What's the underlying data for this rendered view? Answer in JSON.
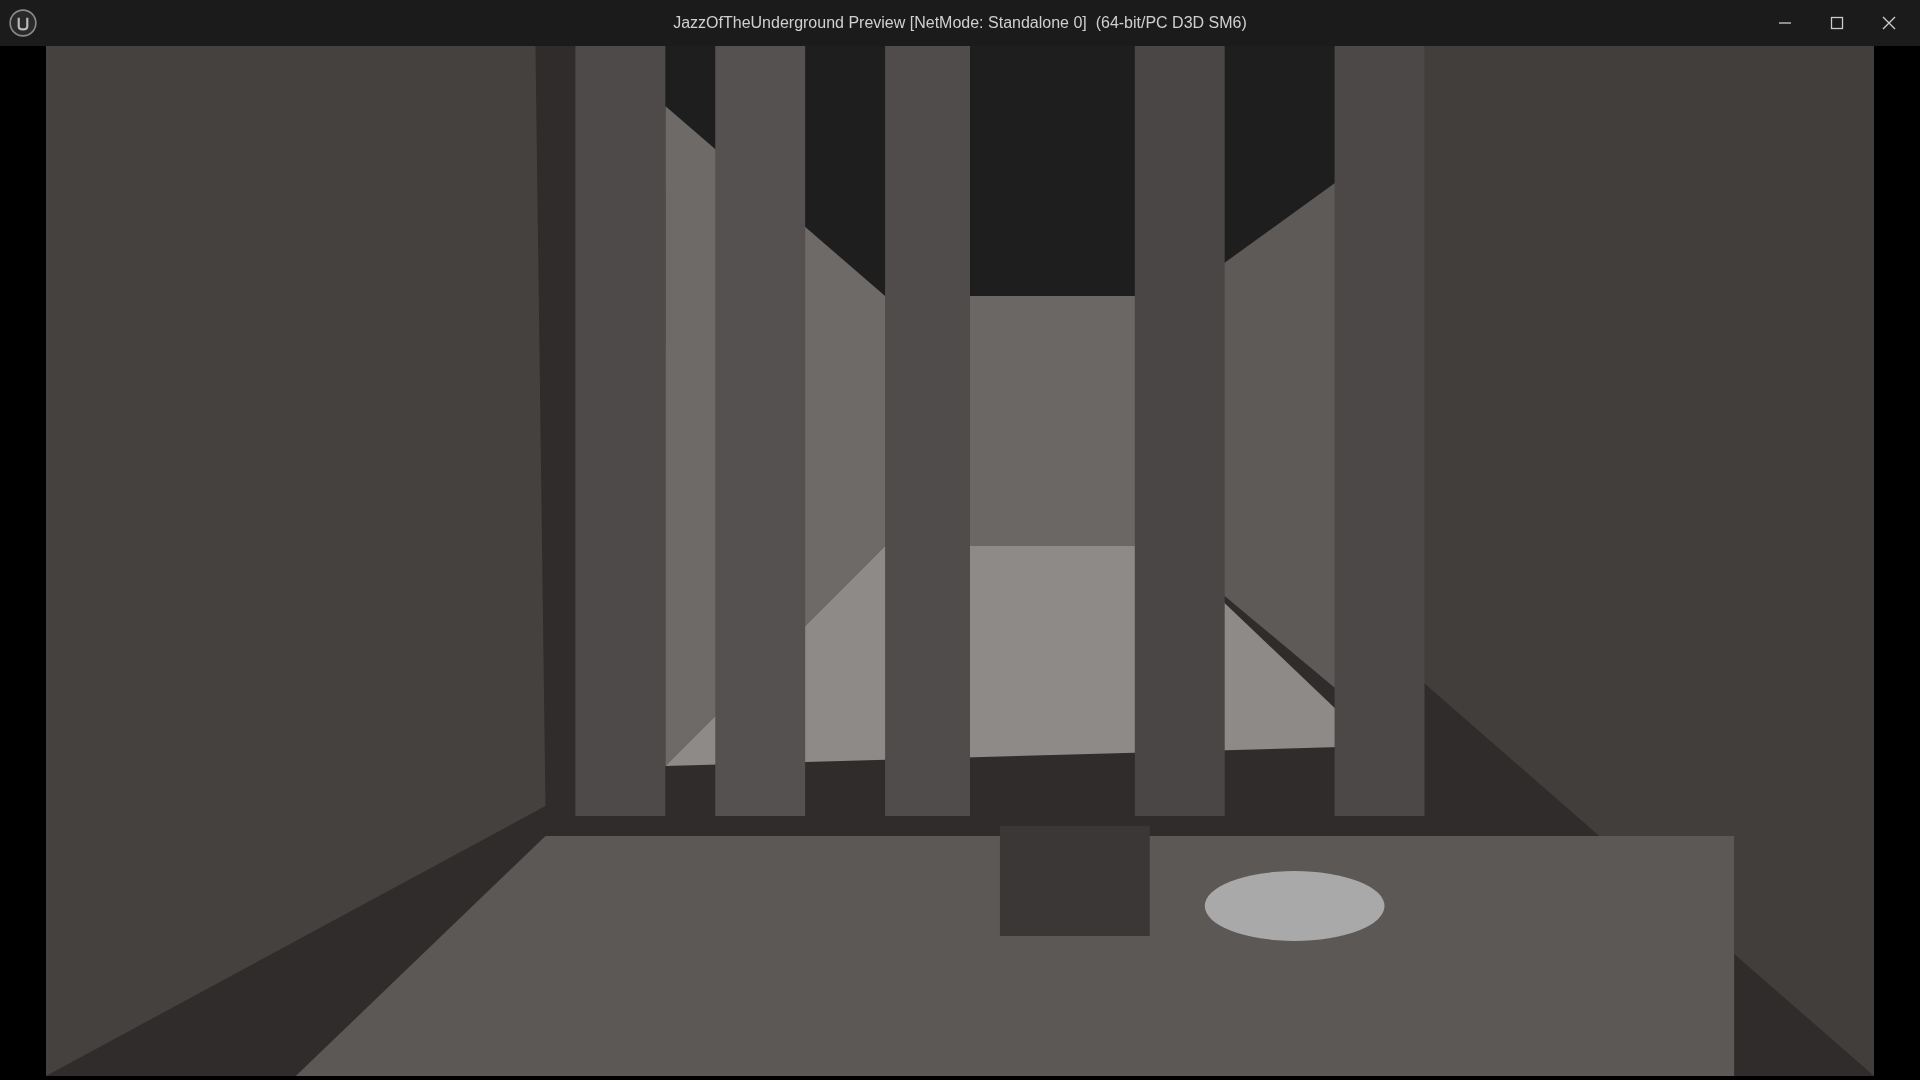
{
  "window": {
    "title": "JazzOfTheUnderground Preview [NetMode: Standalone 0]  (64-bit/PC D3D SM6)"
  }
}
